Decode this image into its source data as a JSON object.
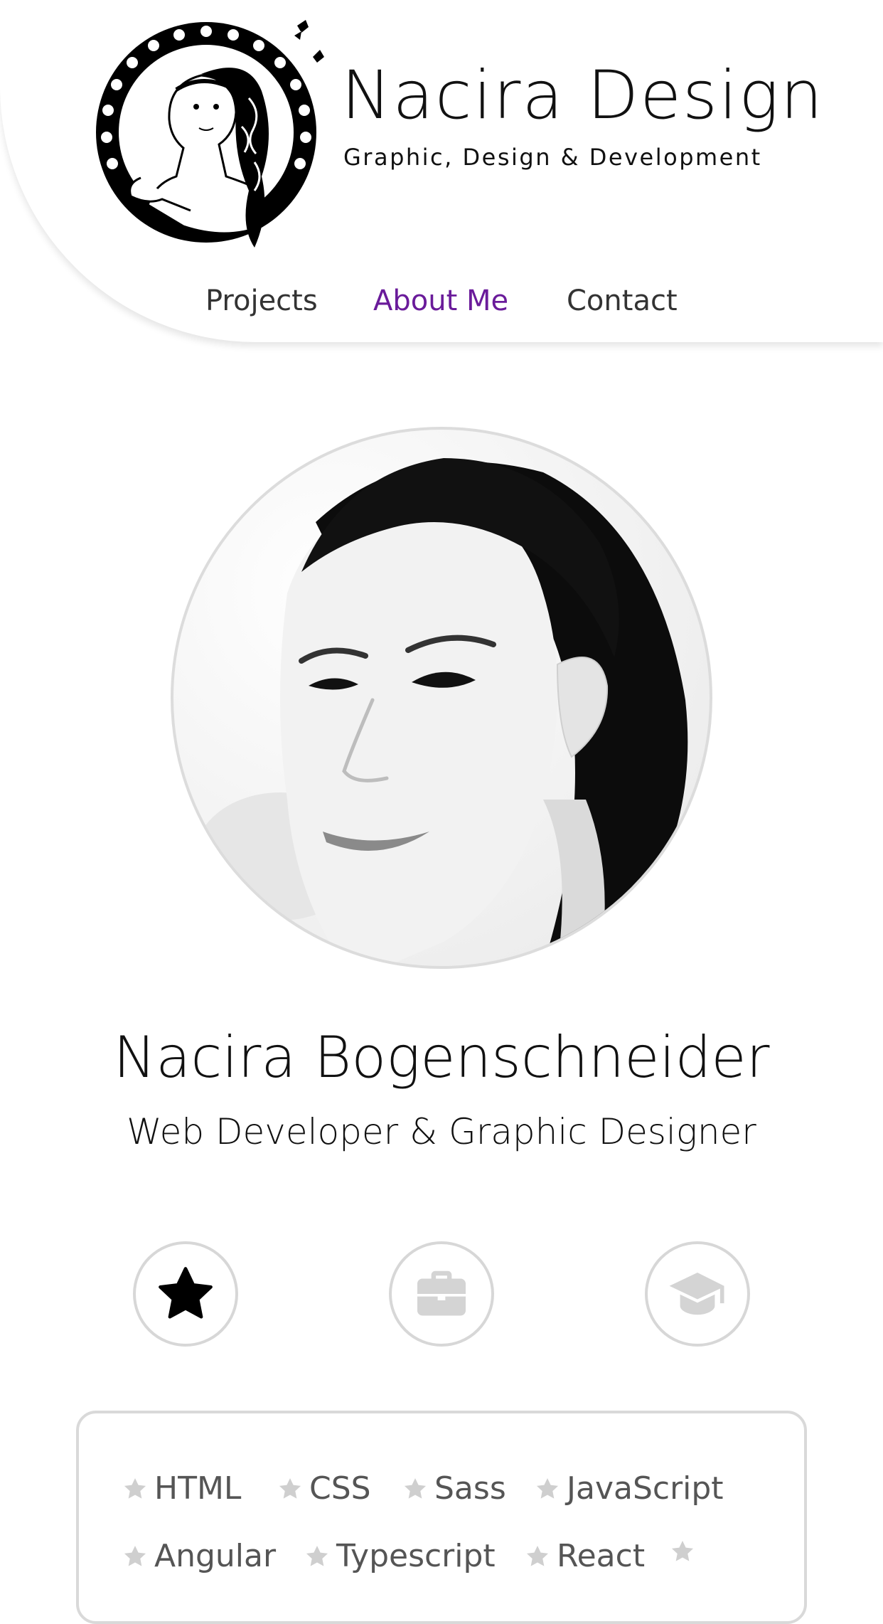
{
  "header": {
    "brand_title": "Nacira  Design",
    "brand_subtitle": "Graphic, Design & Development",
    "logo_icon": "illustrated-girl-emblem-icon"
  },
  "nav": {
    "items": [
      {
        "label": "Projects",
        "active": false
      },
      {
        "label": "About Me",
        "active": true
      },
      {
        "label": "Contact",
        "active": false
      }
    ],
    "active_color": "#6a1b9a"
  },
  "profile": {
    "photo_icon": "portrait-photo",
    "name": "Nacira Bogenschneider",
    "role": "Web Developer & Graphic Designer"
  },
  "tabs": [
    {
      "icon": "star-icon",
      "active": true
    },
    {
      "icon": "briefcase-icon",
      "active": false
    },
    {
      "icon": "graduation-cap-icon",
      "active": false
    }
  ],
  "skills": {
    "items": [
      "HTML",
      "CSS",
      "Sass",
      "JavaScript",
      "Angular",
      "Typescript",
      "React",
      ""
    ],
    "bullet_icon": "star-icon",
    "bullet_color": "#cfcfcf"
  }
}
